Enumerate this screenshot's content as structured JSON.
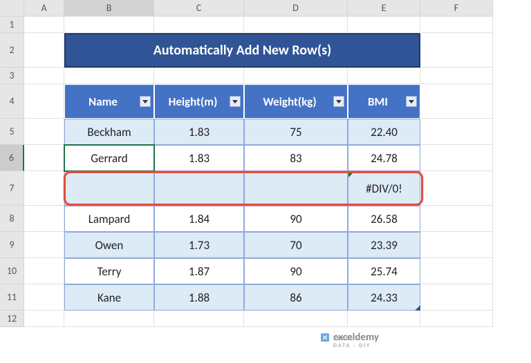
{
  "columns": [
    "",
    "A",
    "B",
    "C",
    "D",
    "E",
    "F"
  ],
  "rows": [
    "1",
    "2",
    "3",
    "4",
    "5",
    "6",
    "7",
    "8",
    "9",
    "10",
    "11",
    "12"
  ],
  "title": "Automatically Add New Row(s)",
  "headers": {
    "name": "Name",
    "height": "Height(m)",
    "weight": "Weight(kg)",
    "bmi": "BMI"
  },
  "data": [
    {
      "name": "Beckham",
      "height": "1.83",
      "weight": "75",
      "bmi": "22.40",
      "band": true
    },
    {
      "name": "Gerrard",
      "height": "1.83",
      "weight": "83",
      "bmi": "24.78",
      "band": false
    },
    {
      "name": "",
      "height": "",
      "weight": "",
      "bmi": "#DIV/0!",
      "band": true
    },
    {
      "name": "Lampard",
      "height": "1.84",
      "weight": "90",
      "bmi": "26.58",
      "band": false
    },
    {
      "name": "Owen",
      "height": "1.73",
      "weight": "70",
      "bmi": "23.39",
      "band": true
    },
    {
      "name": "Terry",
      "height": "1.87",
      "weight": "90",
      "bmi": "25.74",
      "band": false
    },
    {
      "name": "Kane",
      "height": "1.88",
      "weight": "86",
      "bmi": "24.33",
      "band": true
    }
  ],
  "watermark": {
    "brand": "exceldemy",
    "tag": "EXCEL · DATA · DIY"
  },
  "active_cell": {
    "row": 6,
    "col": "B"
  },
  "chart_data": {
    "type": "table",
    "title": "Automatically Add New Row(s)",
    "columns": [
      "Name",
      "Height(m)",
      "Weight(kg)",
      "BMI"
    ],
    "rows": [
      [
        "Beckham",
        1.83,
        75,
        22.4
      ],
      [
        "Gerrard",
        1.83,
        83,
        24.78
      ],
      [
        "",
        null,
        null,
        "#DIV/0!"
      ],
      [
        "Lampard",
        1.84,
        90,
        26.58
      ],
      [
        "Owen",
        1.73,
        70,
        23.39
      ],
      [
        "Terry",
        1.87,
        90,
        25.74
      ],
      [
        "Kane",
        1.88,
        86,
        24.33
      ]
    ]
  }
}
